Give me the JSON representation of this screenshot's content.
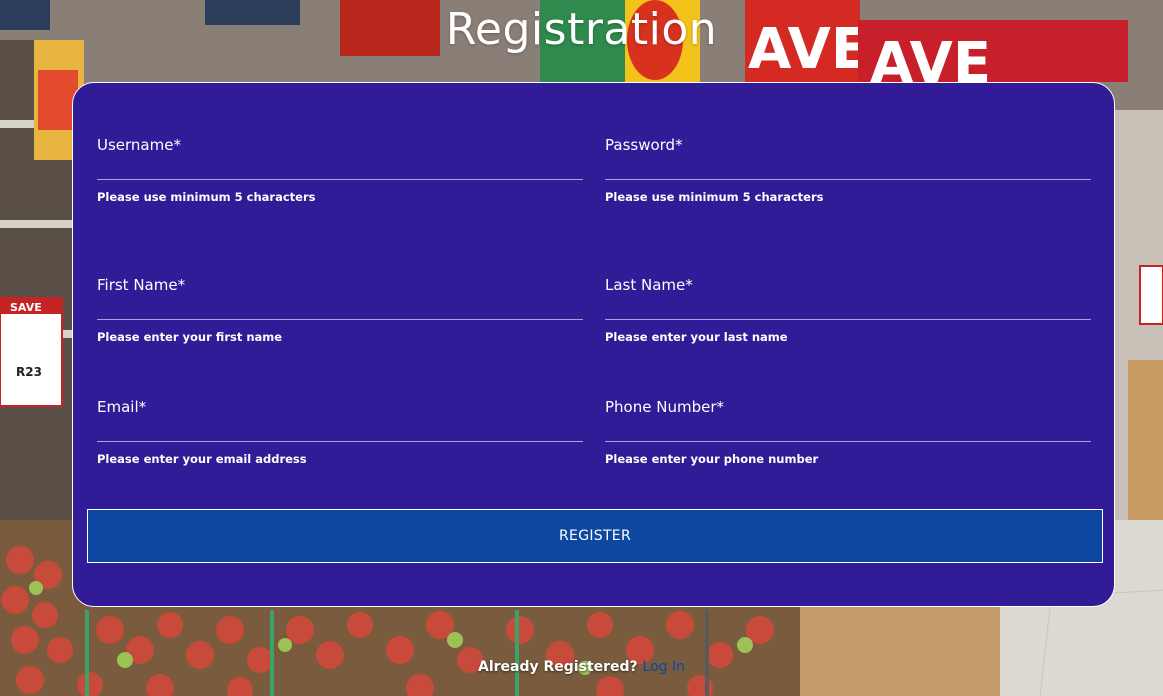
{
  "page": {
    "title": "Registration"
  },
  "form": {
    "fields": [
      {
        "label": "Username*",
        "hint": "Please use minimum 5 characters",
        "value": ""
      },
      {
        "label": "Password*",
        "hint": "Please use minimum 5 characters",
        "value": ""
      },
      {
        "label": "First Name*",
        "hint": "Please enter your first name",
        "value": ""
      },
      {
        "label": "Last Name*",
        "hint": "Please enter your last name",
        "value": ""
      },
      {
        "label": "Email*",
        "hint": "Please enter your email address",
        "value": ""
      },
      {
        "label": "Phone Number*",
        "hint": "Please enter your phone number",
        "value": ""
      }
    ],
    "register_label": "REGISTER"
  },
  "footer": {
    "prompt": "Already Registered?",
    "login_link": "Log In"
  },
  "colors": {
    "card_background": "#311b96",
    "button_background": "#0d47a1",
    "link": "#0d47a1",
    "text": "#ffffff"
  },
  "background": {
    "signs": [
      "AVE",
      "AVE",
      "SAVE",
      "R23"
    ]
  }
}
